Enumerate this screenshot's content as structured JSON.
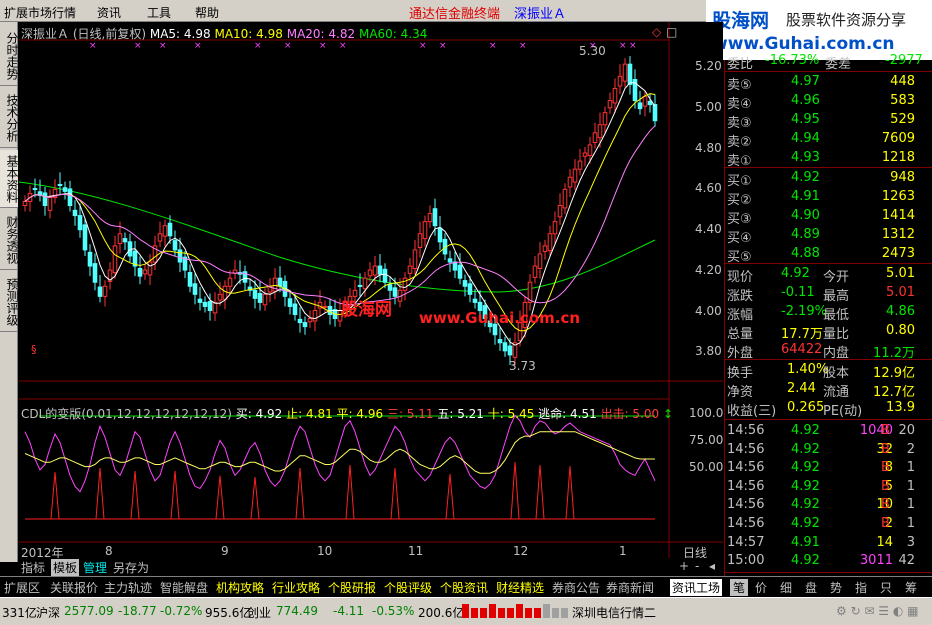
{
  "menu": {
    "items": [
      "扩展市场行情",
      "资讯",
      "工具",
      "帮助"
    ],
    "title_red": "通达信金融终端",
    "title_blue": "深振业Ａ"
  },
  "logo": {
    "line1a": "股海网",
    "line1b": "股票软件资源分享",
    "line2": "www.Guhai.com.cn"
  },
  "left_tabs": [
    "分时走势",
    "技术分析",
    "基本资料",
    "财务透视",
    "预测评级"
  ],
  "chart": {
    "header": {
      "name": "深振业Ａ",
      "period": "(日线,前复权)",
      "ma5": "MA5: 4.98",
      "ma10": "MA10: 4.98",
      "ma20": "MA20: 4.82",
      "ma60": "MA60: 4.34"
    },
    "y_ticks": [
      "5.20",
      "5.00",
      "4.80",
      "4.60",
      "4.40",
      "4.20",
      "4.00",
      "3.80"
    ],
    "high_label": "5.30",
    "low_label": "3.73",
    "watermark1": "股海网",
    "watermark2": "www.Guhai.com.cn",
    "ind_header": {
      "name": "CDL的变版",
      "params": "(0.01,12,12,12,12,12,12)",
      "buy": "买: 4.92",
      "stop": "止: 4.81",
      "flat": "平: 4.96",
      "three": "三: 5.11",
      "five": "五: 5.21",
      "ten": "十: 5.45",
      "escape": "逃命: 4.51",
      "out": "出击: 5.00"
    },
    "ind_ticks": [
      "100.0",
      "75.00",
      "50.00"
    ],
    "x_labels": [
      "2012年",
      "8",
      "9",
      "10",
      "11",
      "12",
      "1"
    ],
    "period_label": "日线",
    "colors": {
      "up": "#ff3232",
      "down": "#54ffff",
      "ma5": "#ffffff",
      "ma10": "#ffff00",
      "ma20": "#ff80ff",
      "ma60": "#00e600"
    }
  },
  "chart_tabs": [
    "指标",
    "模板",
    "管理",
    "另存为"
  ],
  "quote": {
    "wei": {
      "label1": "委比",
      "value1": "-16.73%",
      "label2": "委差",
      "value2": "-2977"
    },
    "sell": [
      {
        "label": "卖⑤",
        "price": "4.97",
        "vol": "448"
      },
      {
        "label": "卖④",
        "price": "4.96",
        "vol": "583"
      },
      {
        "label": "卖③",
        "price": "4.95",
        "vol": "529"
      },
      {
        "label": "卖②",
        "price": "4.94",
        "vol": "7609"
      },
      {
        "label": "卖①",
        "price": "4.93",
        "vol": "1218"
      }
    ],
    "buy": [
      {
        "label": "买①",
        "price": "4.92",
        "vol": "948"
      },
      {
        "label": "买②",
        "price": "4.91",
        "vol": "1263"
      },
      {
        "label": "买③",
        "price": "4.90",
        "vol": "1414"
      },
      {
        "label": "买④",
        "price": "4.89",
        "vol": "1312"
      },
      {
        "label": "买⑤",
        "price": "4.88",
        "vol": "2473"
      }
    ],
    "stats": [
      {
        "l1": "现价",
        "v1": "4.92",
        "l2": "今开",
        "v2": "5.01"
      },
      {
        "l1": "涨跌",
        "v1": "-0.11",
        "l2": "最高",
        "v2": "5.01"
      },
      {
        "l1": "涨幅",
        "v1": "-2.19%",
        "l2": "最低",
        "v2": "4.86"
      },
      {
        "l1": "总量",
        "v1": "17.7万",
        "l2": "量比",
        "v2": "0.80"
      },
      {
        "l1": "外盘",
        "v1": "64422",
        "l2": "内盘",
        "v2": "11.2万"
      }
    ],
    "stats2": [
      {
        "l1": "换手",
        "v1": "1.40%",
        "l2": "股本",
        "v2": "12.9亿"
      },
      {
        "l1": "净资",
        "v1": "2.44",
        "l2": "流通",
        "v2": "12.7亿"
      },
      {
        "l1": "收益(三)",
        "v1": "0.265",
        "l2": "PE(动)",
        "v2": "13.9"
      }
    ],
    "ticks": [
      {
        "time": "14:56",
        "price": "4.92",
        "vol": "1040",
        "bs": "B",
        "n": "20"
      },
      {
        "time": "14:56",
        "price": "4.92",
        "vol": "32",
        "bs": "B",
        "n": "2"
      },
      {
        "time": "14:56",
        "price": "4.92",
        "vol": "8",
        "bs": "B",
        "n": "1"
      },
      {
        "time": "14:56",
        "price": "4.92",
        "vol": "5",
        "bs": "B",
        "n": "1"
      },
      {
        "time": "14:56",
        "price": "4.92",
        "vol": "10",
        "bs": "B",
        "n": "1"
      },
      {
        "time": "14:56",
        "price": "4.92",
        "vol": "2",
        "bs": "B",
        "n": "1"
      },
      {
        "time": "14:57",
        "price": "4.91",
        "vol": "14",
        "bs": "",
        "n": "3"
      },
      {
        "time": "15:00",
        "price": "4.92",
        "vol": "3011",
        "bs": "",
        "n": "42"
      }
    ],
    "tabs": [
      "笔",
      "价",
      "细",
      "盘",
      "势",
      "指",
      "只",
      "筹"
    ]
  },
  "category_bar": [
    "扩展区",
    "关联报价",
    "主力轨迹",
    "智能解盘",
    "机构攻略",
    "行业攻略",
    "个股研报",
    "个股评级",
    "个股资讯",
    "财经精选",
    "券商公告",
    "券商新闻",
    "资讯工场"
  ],
  "status": {
    "lead": "331亿",
    "sh": {
      "label": "沪深",
      "value": "2577.09",
      "change": "-18.77",
      "pct": "-0.72%",
      "amount": "955.6亿"
    },
    "cy": {
      "label": "创业",
      "value": "774.49",
      "change": "-4.11",
      "pct": "-0.53%",
      "amount": "200.6亿"
    },
    "server": "深圳电信行情二"
  },
  "price_series": [
    4.52,
    4.56,
    4.58,
    4.55,
    4.5,
    4.54,
    4.58,
    4.6,
    4.57,
    4.5,
    4.45,
    4.38,
    4.28,
    4.2,
    4.12,
    4.05,
    4.1,
    4.18,
    4.3,
    4.36,
    4.32,
    4.25,
    4.2,
    4.15,
    4.18,
    4.22,
    4.3,
    4.36,
    4.4,
    4.35,
    4.28,
    4.22,
    4.18,
    4.1,
    4.06,
    4.02,
    4.0,
    3.98,
    4.02,
    4.06,
    4.1,
    4.14,
    4.18,
    4.16,
    4.12,
    4.08,
    4.04,
    4.02,
    4.06,
    4.1,
    4.14,
    4.1,
    4.05,
    4.0,
    3.96,
    3.92,
    3.9,
    3.94,
    3.98,
    4.02,
    4.0,
    3.96,
    3.94,
    3.98,
    4.02,
    4.05,
    4.08,
    4.1,
    4.14,
    4.18,
    4.2,
    4.16,
    4.12,
    4.08,
    4.05,
    4.08,
    4.14,
    4.2,
    4.28,
    4.36,
    4.42,
    4.46,
    4.4,
    4.32,
    4.26,
    4.22,
    4.18,
    4.14,
    4.1,
    4.06,
    4.02,
    3.98,
    3.94,
    3.9,
    3.86,
    3.82,
    3.78,
    3.76,
    3.82,
    3.92,
    4.02,
    4.12,
    4.2,
    4.26,
    4.3,
    4.36,
    4.42,
    4.5,
    4.58,
    4.64,
    4.68,
    4.72,
    4.76,
    4.8,
    4.86,
    4.9,
    4.96,
    5.02,
    5.08,
    5.14,
    5.2,
    5.1,
    5.02,
    4.98,
    5.04,
    5.0,
    4.92
  ],
  "ind_series": {
    "purple": [
      80,
      70,
      55,
      45,
      50,
      65,
      78,
      70,
      55,
      40,
      30,
      25,
      35,
      50,
      70,
      85,
      75,
      60,
      45,
      40,
      50,
      65,
      80,
      75,
      60,
      45,
      35,
      40,
      55,
      70,
      80,
      70,
      55,
      40,
      30,
      28,
      35,
      45,
      60,
      72,
      65,
      50,
      40,
      45,
      55,
      65,
      70,
      60,
      45,
      35,
      30,
      35,
      45,
      60,
      75,
      85,
      80,
      65,
      50,
      40,
      35,
      40,
      55,
      70,
      85,
      90,
      80,
      65,
      50,
      40,
      45,
      55,
      65,
      75,
      85,
      80,
      70,
      55,
      45,
      40,
      35,
      40,
      50,
      60,
      70,
      75,
      70,
      60,
      50,
      40,
      35,
      30,
      28,
      32,
      40,
      55,
      70,
      85,
      95,
      90,
      80,
      75,
      85,
      90,
      88,
      82,
      78,
      80,
      85,
      88,
      84,
      80,
      78,
      76,
      74,
      72,
      70,
      68,
      60,
      50,
      45,
      42,
      40,
      48,
      55,
      45,
      35
    ],
    "yellow": [
      60,
      58,
      56,
      54,
      52,
      52,
      54,
      56,
      56,
      54,
      52,
      50,
      48,
      48,
      50,
      54,
      56,
      56,
      54,
      52,
      52,
      54,
      56,
      56,
      54,
      52,
      50,
      50,
      52,
      54,
      56,
      54,
      52,
      50,
      48,
      46,
      46,
      48,
      50,
      52,
      52,
      50,
      48,
      48,
      50,
      52,
      52,
      50,
      48,
      46,
      44,
      44,
      46,
      50,
      54,
      58,
      58,
      56,
      54,
      52,
      50,
      50,
      52,
      56,
      60,
      64,
      64,
      62,
      58,
      54,
      52,
      52,
      54,
      58,
      62,
      64,
      62,
      58,
      54,
      50,
      48,
      46,
      46,
      48,
      52,
      56,
      58,
      56,
      52,
      48,
      44,
      42,
      42,
      42,
      44,
      48,
      54,
      62,
      70,
      74,
      76,
      76,
      78,
      80,
      80,
      80,
      80,
      80,
      80,
      80,
      80,
      78,
      76,
      74,
      72,
      70,
      68,
      66,
      64,
      62,
      60,
      58,
      56,
      55,
      55,
      55,
      55
    ]
  }
}
